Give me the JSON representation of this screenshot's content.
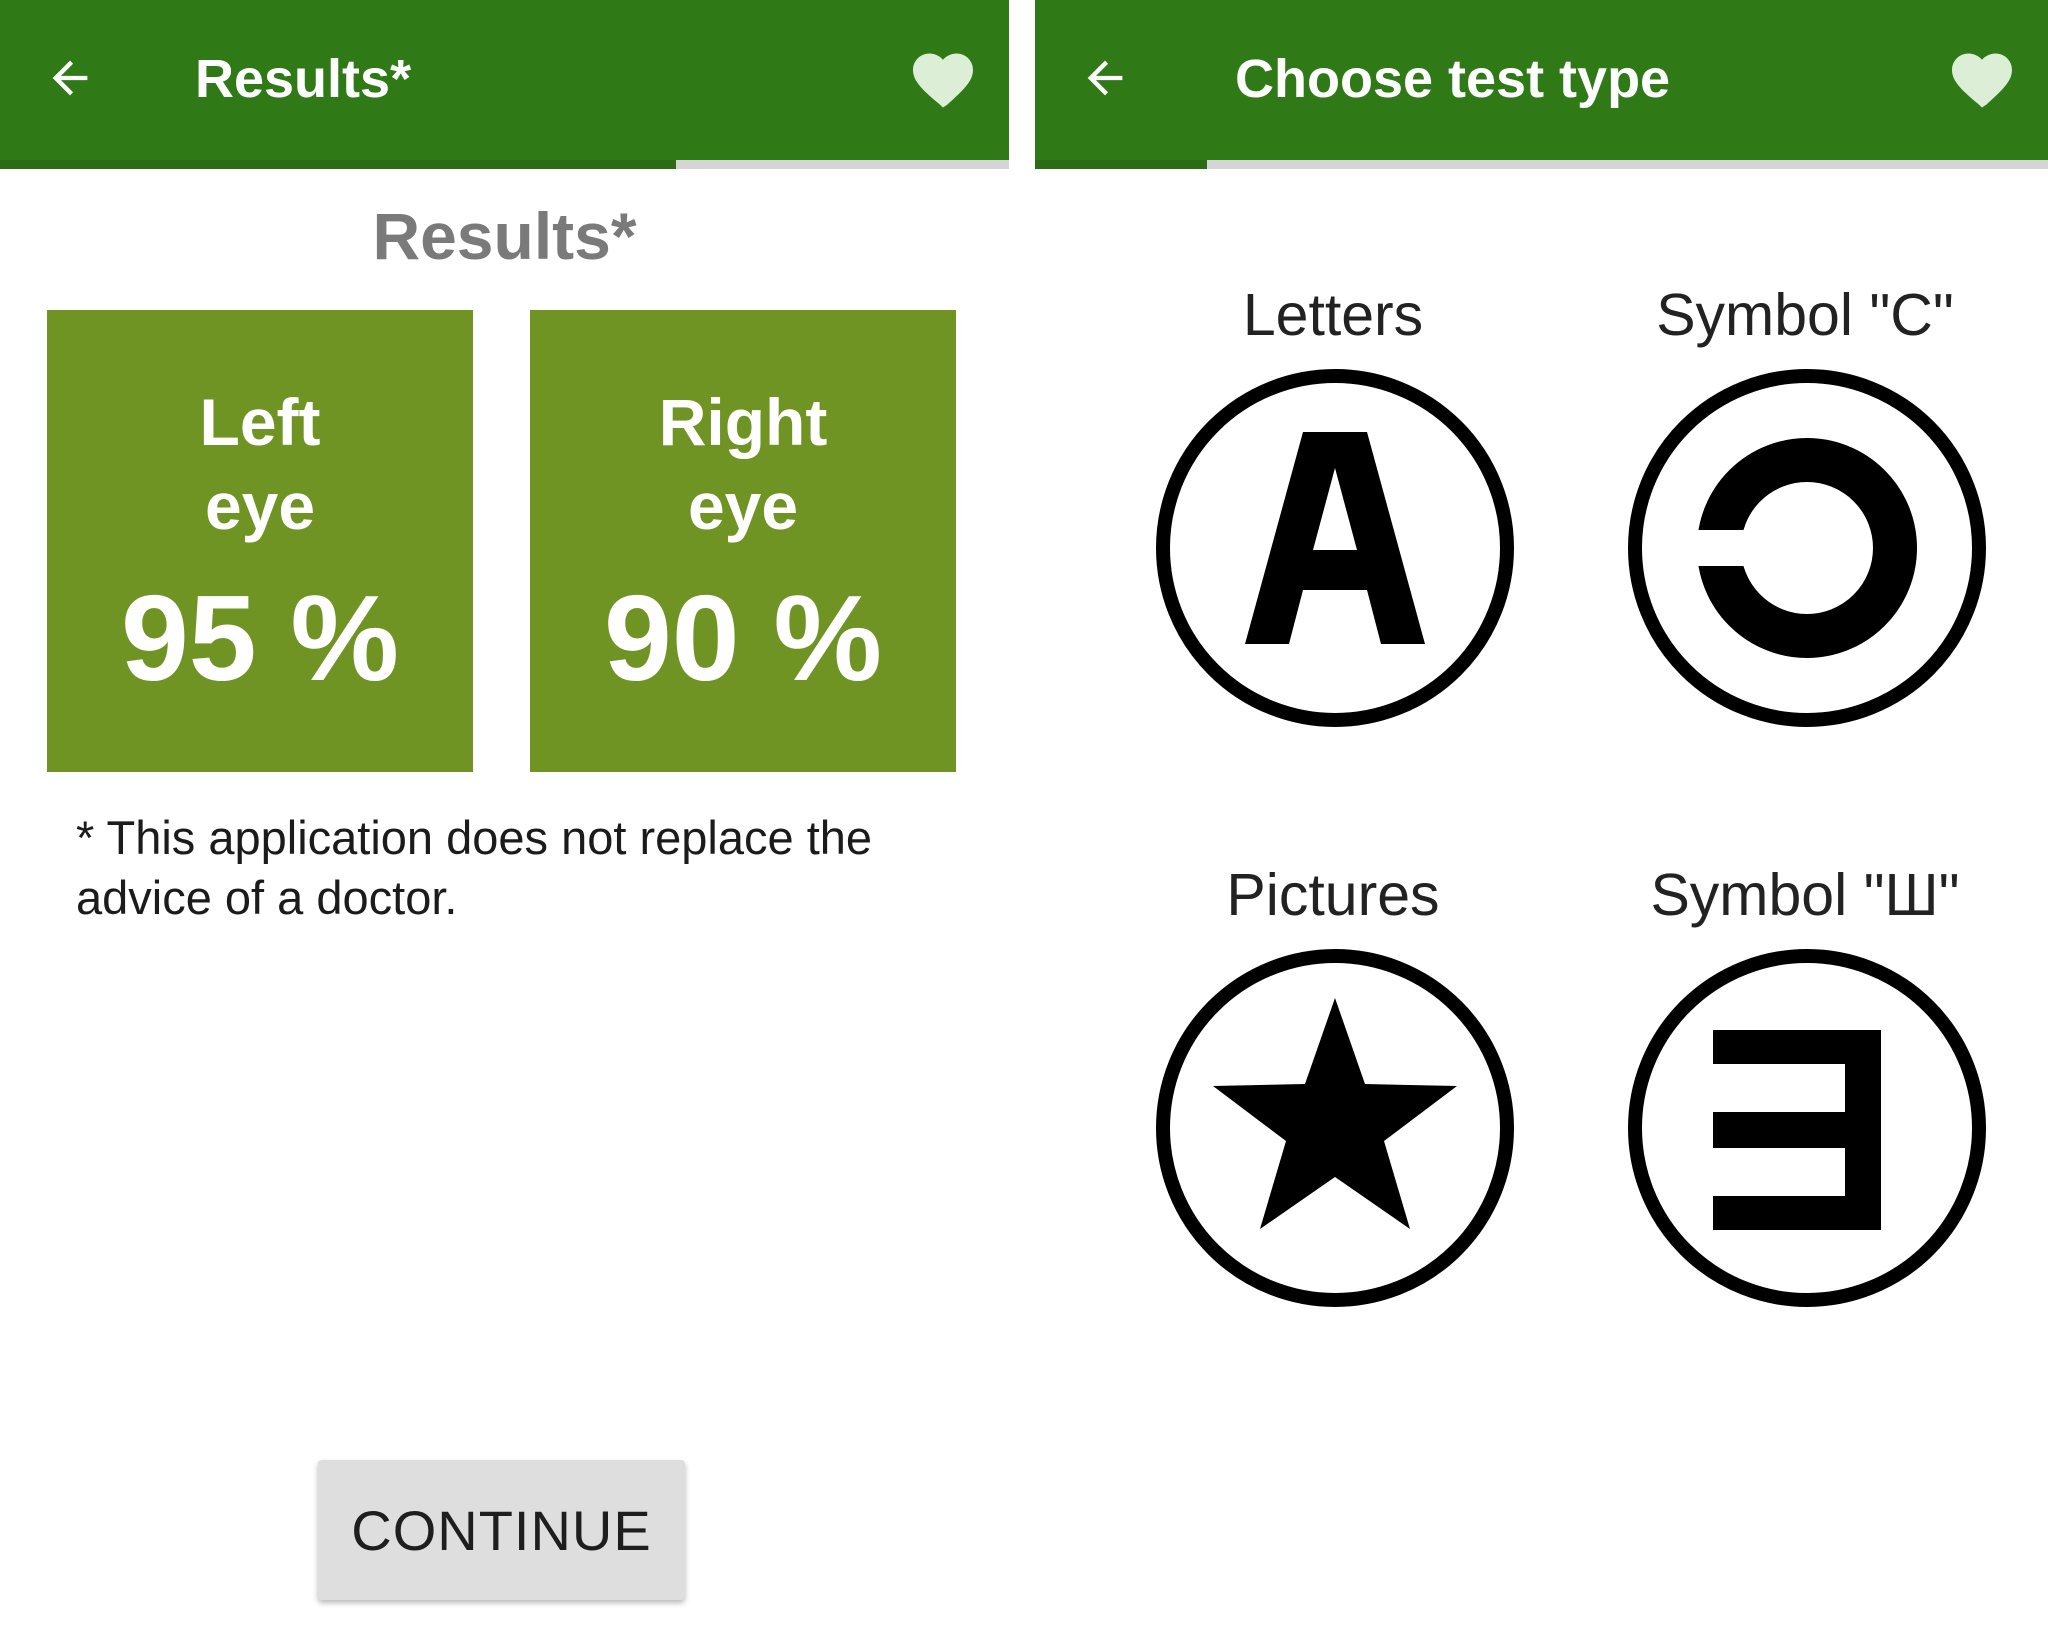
{
  "results_screen": {
    "appbar": {
      "title": "Results*"
    },
    "progress": 0.67,
    "heading": "Results*",
    "left_eye": {
      "label": "Left eye",
      "value": "95 %"
    },
    "right_eye": {
      "label": "Right eye",
      "value": "90 %"
    },
    "disclaimer": "* This application does not replace the advice of a doctor.",
    "continue_label": "CONTINUE"
  },
  "test_type_screen": {
    "appbar": {
      "title": "Choose test type"
    },
    "progress": 0.17,
    "options": [
      {
        "label": "Letters",
        "icon": "letter-a-icon"
      },
      {
        "label": "Symbol \"C\"",
        "icon": "landolt-c-icon"
      },
      {
        "label": "Pictures",
        "icon": "star-icon"
      },
      {
        "label": "Symbol \"Ш\"",
        "icon": "tumbling-e-icon"
      }
    ]
  },
  "colors": {
    "appbar": "#2f7a17",
    "progress_fill": "#2c6a14",
    "progress_track": "#d5d5d5",
    "tile": "#6f9423",
    "heading": "#7a7a7a",
    "heart": "#dcefd6"
  }
}
